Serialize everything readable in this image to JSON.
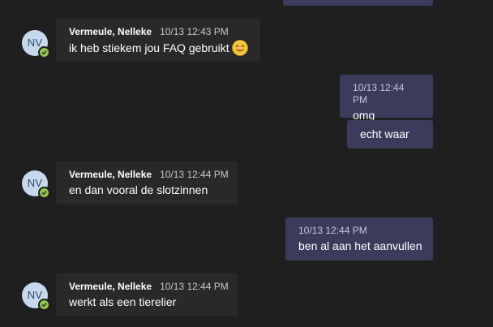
{
  "messages": [
    {
      "direction": "incoming",
      "avatar_initials": "NV",
      "sender": "Vermeule, Nelleke",
      "timestamp": "10/13 12:43 PM",
      "text": "ik heb stiekem jou FAQ gebruikt",
      "emoji": "smiling-face-emoji"
    },
    {
      "direction": "outgoing",
      "timestamp": "10/13 12:44 PM",
      "text": "omg"
    },
    {
      "direction": "outgoing",
      "text": "echt waar"
    },
    {
      "direction": "incoming",
      "avatar_initials": "NV",
      "sender": "Vermeule, Nelleke",
      "timestamp": "10/13 12:44 PM",
      "text": "en dan vooral de slotzinnen"
    },
    {
      "direction": "outgoing",
      "timestamp": "10/13 12:44 PM",
      "text": "ben al aan het aanvullen"
    },
    {
      "direction": "incoming",
      "avatar_initials": "NV",
      "sender": "Vermeule, Nelleke",
      "timestamp": "10/13 12:44 PM",
      "text": "werkt als een tierelier"
    }
  ],
  "presence_status": "available",
  "colors": {
    "background": "#1f1f1f",
    "incoming_bubble": "#292929",
    "outgoing_bubble": "#3b3c5c",
    "presence_available": "#92c353",
    "avatar_bg": "#c7d8ec"
  }
}
